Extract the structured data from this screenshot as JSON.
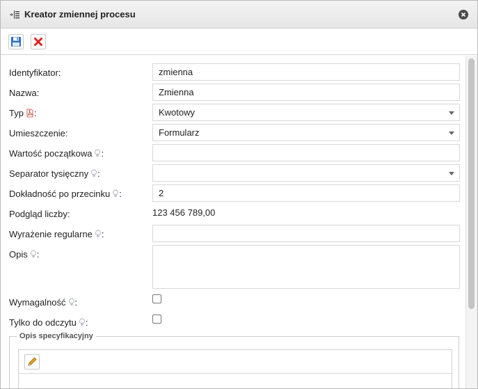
{
  "window": {
    "title": "Kreator zmiennej procesu"
  },
  "icons": {
    "title": "tree-structure-icon",
    "close": "close-circle-icon",
    "save": "floppy-disk-icon",
    "cancel": "red-x-icon",
    "hint": "lightbulb-icon",
    "required": "pdf-document-icon",
    "edit": "pencil-icon"
  },
  "form": {
    "identifier": {
      "label": "Identyfikator:",
      "value": "zmienna"
    },
    "name": {
      "label": "Nazwa:",
      "value": "Zmienna"
    },
    "type": {
      "label_prefix": "Typ",
      "label_suffix": ":",
      "value": "Kwotowy"
    },
    "placement": {
      "label": "Umieszczenie:",
      "value": "Formularz"
    },
    "initial_value": {
      "label": "Wartość początkowa",
      "suffix": ":",
      "value": ""
    },
    "thousand_separator": {
      "label": "Separator tysięczny",
      "suffix": ":",
      "value": ""
    },
    "decimal_precision": {
      "label": "Dokładność po przecinku",
      "suffix": ":",
      "value": "2"
    },
    "number_preview": {
      "label": "Podgląd liczby:",
      "value": "123 456 789,00"
    },
    "regex": {
      "label": "Wyrażenie regularne",
      "suffix": ":",
      "value": ""
    },
    "description": {
      "label": "Opis",
      "suffix": ":",
      "value": ""
    },
    "required_flag": {
      "label": "Wymagalność",
      "suffix": ":",
      "checked": false
    },
    "read_only": {
      "label": "Tylko do odczytu",
      "suffix": ":",
      "checked": false
    },
    "spec_description": {
      "legend": "Opis specyfikacyjny"
    }
  },
  "colors": {
    "cancel_red": "#e02020",
    "save_blue": "#2a6fc9",
    "pencil_orange": "#e8a21c"
  }
}
